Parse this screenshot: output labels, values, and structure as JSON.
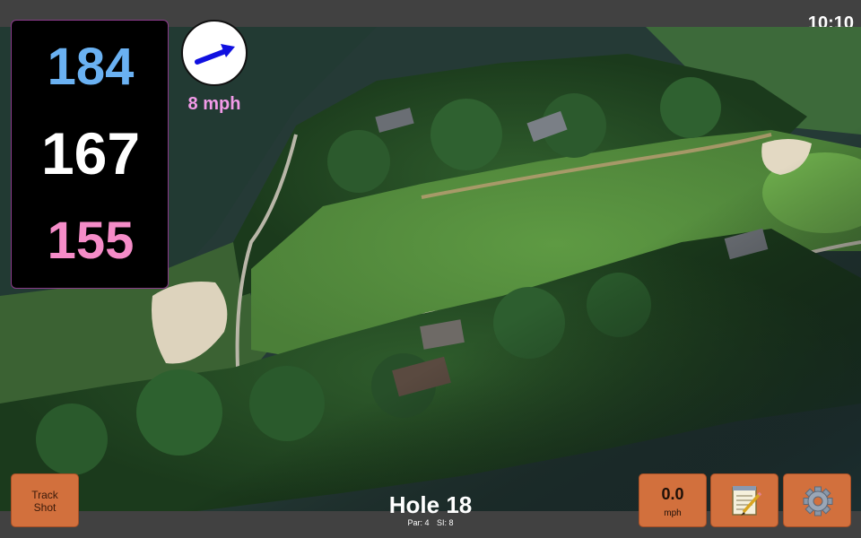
{
  "header": {
    "time": "10:10"
  },
  "distances": {
    "back": "184",
    "middle": "167",
    "front": "155",
    "colors": {
      "back": "#6ab1f2",
      "middle": "#ffffff",
      "front": "#f58cc8"
    }
  },
  "wind": {
    "speed_label": "8 mph",
    "arrow_icon": "wind-arrow-icon",
    "arrow_color": "#1010e0"
  },
  "hole": {
    "title": "Hole 18",
    "par_label": "Par: 4",
    "si_label": "SI: 8"
  },
  "buttons": {
    "track_shot_line1": "Track",
    "track_shot_line2": "Shot",
    "speed_value": "0.0",
    "speed_unit": "mph",
    "notes_icon": "notepad-icon",
    "settings_icon": "gear-icon",
    "color": "#d2703d"
  }
}
